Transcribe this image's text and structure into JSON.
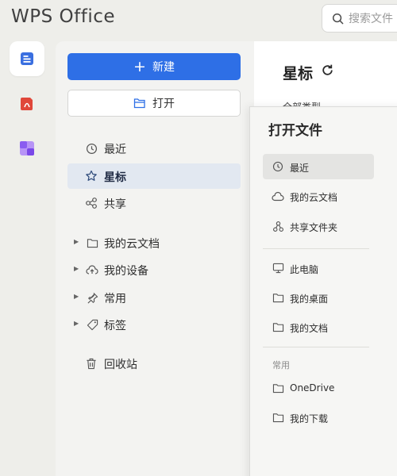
{
  "app": {
    "brand": "WPS Office",
    "search_placeholder": "搜索文件"
  },
  "sidebar": {
    "new_label": "新建",
    "open_label": "打开",
    "nav": [
      {
        "label": "最近",
        "icon": "clock-icon"
      },
      {
        "label": "星标",
        "icon": "star-icon",
        "selected": true
      },
      {
        "label": "共享",
        "icon": "share-icon"
      }
    ],
    "tree": [
      {
        "label": "我的云文档",
        "icon": "folder-icon"
      },
      {
        "label": "我的设备",
        "icon": "cloud-upload-icon"
      },
      {
        "label": "常用",
        "icon": "pin-icon"
      },
      {
        "label": "标签",
        "icon": "tag-icon"
      }
    ],
    "trash": {
      "label": "回收站",
      "icon": "trash-icon"
    }
  },
  "main": {
    "title": "星标",
    "peek_text": "全部类型"
  },
  "open_panel": {
    "title": "打开文件",
    "group1": [
      {
        "label": "最近",
        "icon": "clock-icon",
        "selected": true
      },
      {
        "label": "我的云文档",
        "icon": "cloud-icon"
      },
      {
        "label": "共享文件夹",
        "icon": "share-icon"
      }
    ],
    "group2": [
      {
        "label": "此电脑",
        "icon": "monitor-icon"
      },
      {
        "label": "我的桌面",
        "icon": "folder-icon"
      },
      {
        "label": "我的文档",
        "icon": "folder-icon"
      }
    ],
    "section_label": "常用",
    "group3": [
      {
        "label": "OneDrive",
        "icon": "folder-icon"
      },
      {
        "label": "我的下载",
        "icon": "folder-icon"
      }
    ]
  },
  "colors": {
    "accent": "#2e6fe6",
    "selected_bg": "#e2e8f1",
    "rail_docs": "#3a6fe0",
    "rail_pdf": "#e0473a",
    "rail_apps": "#8a5cf0"
  }
}
